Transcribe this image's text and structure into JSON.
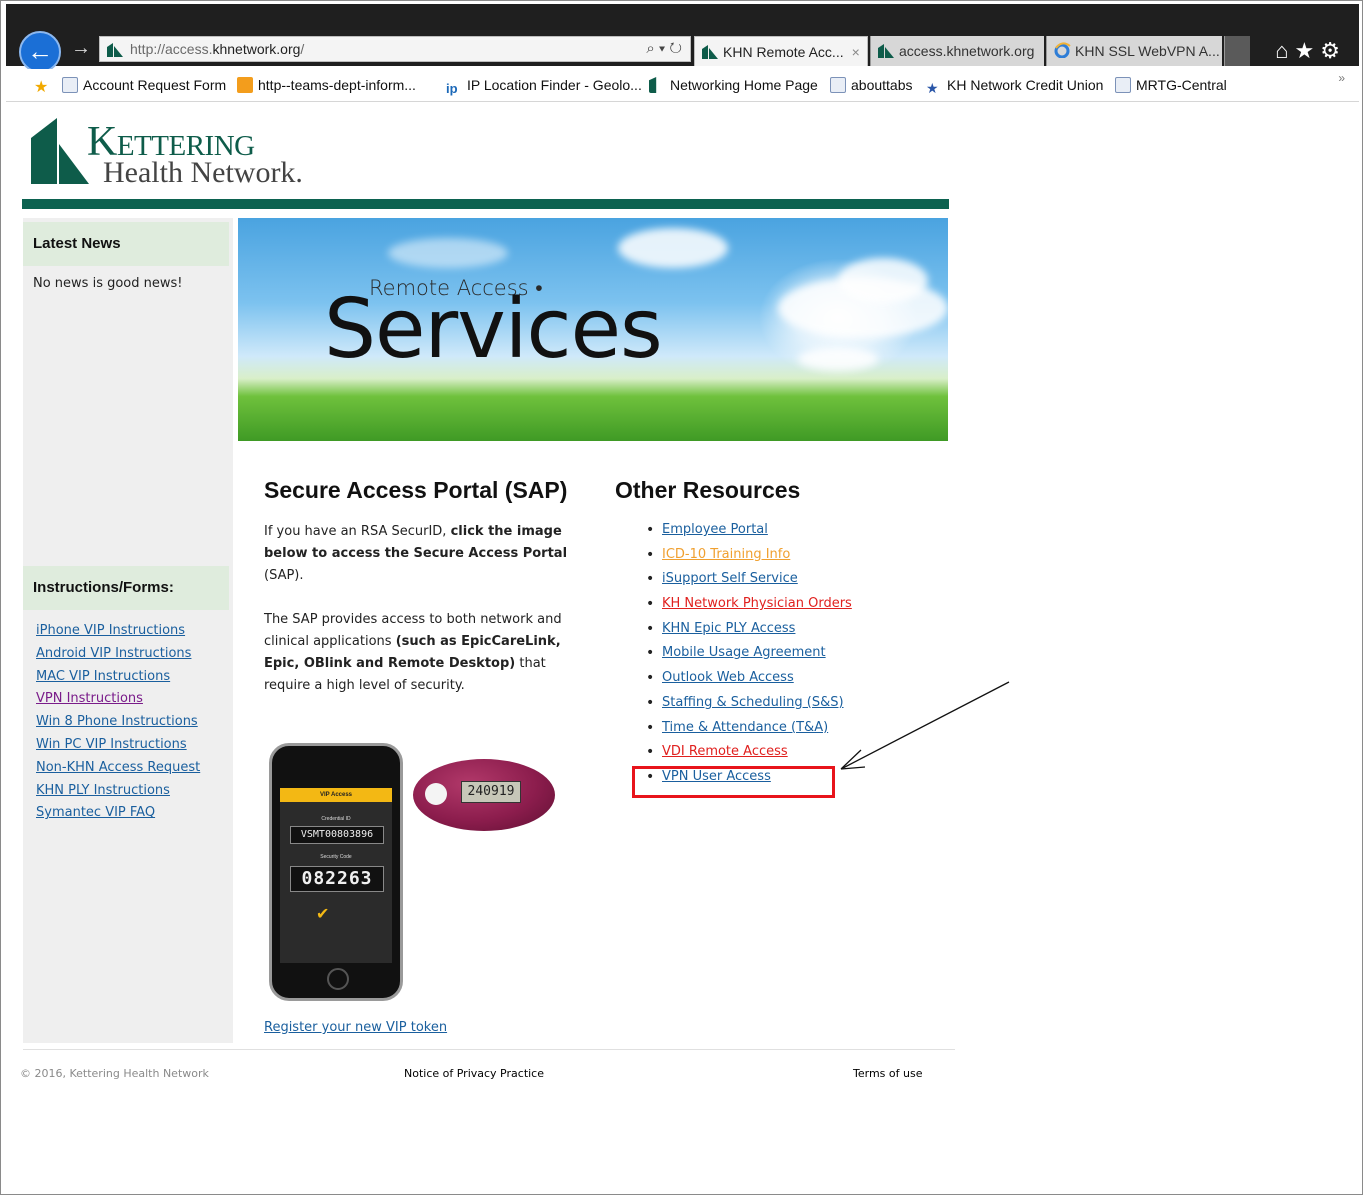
{
  "browser": {
    "back_label": "←",
    "forward_label": "→",
    "url_prefix": "http://access.",
    "url_domain": "khnetwork.org",
    "url_suffix": "/",
    "address_tools": "⌕ ▾ ↻",
    "tabs": [
      {
        "label": "KHN Remote Acc...",
        "active": true
      },
      {
        "label": "access.khnetwork.org",
        "active": false
      },
      {
        "label": "KHN SSL WebVPN A...",
        "active": false
      }
    ],
    "tab_close": "×",
    "chrome_icons": "⌂★⚙"
  },
  "favorites": {
    "items": [
      {
        "label": "Account Request Form",
        "icon": "ie-page-icon"
      },
      {
        "label": "http--teams-dept-inform...",
        "icon": "orange-page-icon"
      },
      {
        "label": "IP Location Finder - Geolo...",
        "icon": "ip-icon"
      },
      {
        "label": "Networking Home Page",
        "icon": "khn-logo-icon"
      },
      {
        "label": "abouttabs",
        "icon": "ie-page-icon"
      },
      {
        "label": "KH Network Credit Union",
        "icon": "star-icon"
      },
      {
        "label": "MRTG-Central",
        "icon": "ie-page-icon"
      }
    ],
    "more": "»"
  },
  "logo": {
    "line1": "Kettering",
    "line2": "Health Network."
  },
  "sidebar": {
    "news_heading": "Latest News",
    "news_text": "No news is good news!",
    "forms_heading": "Instructions/Forms:",
    "links": [
      {
        "label": "iPhone VIP Instructions",
        "visited": false
      },
      {
        "label": "Android VIP Instructions",
        "visited": false
      },
      {
        "label": "MAC VIP Instructions",
        "visited": false
      },
      {
        "label": "VPN Instructions",
        "visited": true
      },
      {
        "label": "Win 8 Phone Instructions",
        "visited": false
      },
      {
        "label": "Win PC VIP Instructions",
        "visited": false
      },
      {
        "label": "Non-KHN Access Request",
        "visited": false
      },
      {
        "label": "KHN PLY Instructions",
        "visited": false
      },
      {
        "label": "Symantec VIP FAQ",
        "visited": false
      }
    ]
  },
  "banner": {
    "subtitle": "Remote Access •",
    "title": "Services"
  },
  "sap": {
    "heading": "Secure Access Portal (SAP)",
    "p1_a": "If you have an RSA SecurID, ",
    "p1_b": "click the image below to access the Secure Access Portal",
    "p1_c": " (SAP).",
    "p2_a": "The SAP provides access to both network and clinical applications ",
    "p2_b": "(such as EpicCareLink, Epic, OBlink and Remote Desktop)",
    "p2_c": " that require a high level of security.",
    "register_link": "Register your new VIP token"
  },
  "token": {
    "app_title": "VIP Access",
    "credential_label": "Credential ID",
    "credential_id": "VSMT00803896",
    "security_label": "Security Code",
    "security_code": "082263",
    "fob_code": "240919"
  },
  "resources": {
    "heading": "Other Resources",
    "links": [
      {
        "label": "Employee Portal",
        "color": "#1a5f9e"
      },
      {
        "label": "ICD-10 Training Info",
        "color": "#f0a030"
      },
      {
        "label": "iSupport Self Service",
        "color": "#1a5f9e"
      },
      {
        "label": "KH Network Physician Orders",
        "color": "#e0201e"
      },
      {
        "label": "KHN Epic PLY Access",
        "color": "#1a5f9e"
      },
      {
        "label": "Mobile Usage Agreement",
        "color": "#1a5f9e"
      },
      {
        "label": "Outlook Web Access",
        "color": "#1a5f9e"
      },
      {
        "label": "Staffing & Scheduling (S&S)",
        "color": "#1a5f9e"
      },
      {
        "label": "Time & Attendance (T&A)",
        "color": "#1a5f9e"
      },
      {
        "label": "VDI Remote Access",
        "color": "#e0201e"
      },
      {
        "label": "VPN User Access",
        "color": "#1a5f9e"
      }
    ]
  },
  "footer": {
    "copyright": "© 2016, Kettering Health Network",
    "privacy": "Notice of Privacy Practice",
    "terms": "Terms of use"
  },
  "colors": {
    "brand_green": "#0c6250",
    "highlight_red": "#e8141b",
    "link": "#1a5f9e"
  }
}
